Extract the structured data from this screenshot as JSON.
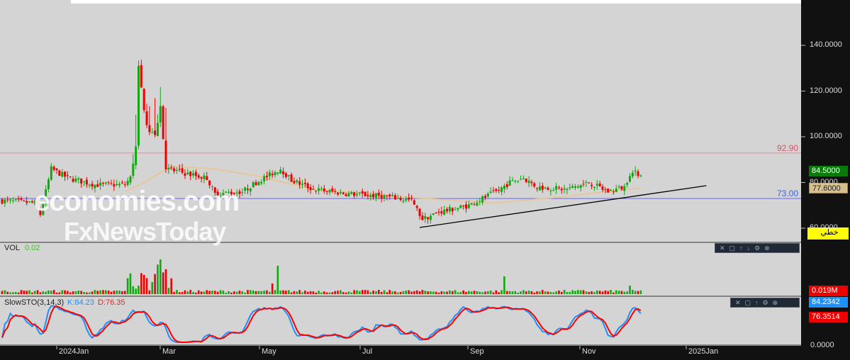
{
  "price_axis": {
    "ticks": [
      "140.0000",
      "120.0000",
      "100.0000",
      "80.0000",
      "60.0000"
    ],
    "last_price": "84.5000",
    "ma_value": "77.6000",
    "tool_label": "خطي"
  },
  "levels": {
    "resistance": "92.90",
    "support": "73.00"
  },
  "volume": {
    "label": "VOL",
    "value": "0.02",
    "axis_value": "0.019M"
  },
  "stoch": {
    "label": "SlowSTO(3,14,3)",
    "k": "K:84.23",
    "d": "D:76.35",
    "k_axis": "84.2342",
    "d_axis": "76.3514",
    "zero": "0.0000"
  },
  "x_axis": [
    "2024Jan",
    "Mar",
    "May",
    "Jul",
    "Sep",
    "Nov",
    "2025Jan"
  ],
  "watermark": {
    "line1": "economies.com",
    "line2": "FxNewsToday"
  },
  "toolbar_icons": [
    "close-icon",
    "window-icon",
    "up-icon",
    "down-icon",
    "settings-icon",
    "close-circle-icon"
  ],
  "colors": {
    "up": "#11a811",
    "down": "#ee0000",
    "ma": "#e6c79a",
    "resistance": "#e88a96",
    "support": "#6a6ae0",
    "k": "#1e90ff",
    "d": "#ff0000"
  },
  "chart_data": {
    "type": "candlestick",
    "title": "",
    "ylim": [
      55,
      150
    ],
    "x_ticks": [
      "2024Jan",
      "Mar",
      "May",
      "Jul",
      "Sep",
      "Nov",
      "2025Jan"
    ],
    "close_path_anchors": [
      [
        0,
        72
      ],
      [
        12,
        71
      ],
      [
        14,
        66
      ],
      [
        18,
        86
      ],
      [
        24,
        82
      ],
      [
        34,
        79
      ],
      [
        45,
        79
      ],
      [
        47,
        82
      ],
      [
        49,
        96
      ],
      [
        50,
        130
      ],
      [
        53,
        104
      ],
      [
        56,
        100
      ],
      [
        58,
        114
      ],
      [
        60,
        86
      ],
      [
        67,
        84
      ],
      [
        75,
        82
      ],
      [
        78,
        75
      ],
      [
        88,
        76
      ],
      [
        93,
        80
      ],
      [
        102,
        86
      ],
      [
        106,
        81
      ],
      [
        114,
        77
      ],
      [
        127,
        75
      ],
      [
        140,
        74
      ],
      [
        150,
        72
      ],
      [
        154,
        64
      ],
      [
        160,
        67
      ],
      [
        171,
        70
      ],
      [
        181,
        76
      ],
      [
        186,
        80
      ],
      [
        191,
        82
      ],
      [
        196,
        78
      ],
      [
        207,
        77
      ],
      [
        215,
        80
      ],
      [
        222,
        76
      ],
      [
        228,
        78
      ],
      [
        230,
        84
      ],
      [
        234,
        84
      ]
    ],
    "ma_anchors": [
      [
        45,
        76
      ],
      [
        52,
        80
      ],
      [
        62,
        87
      ],
      [
        77,
        86
      ],
      [
        93,
        83
      ],
      [
        114,
        77
      ],
      [
        135,
        75
      ],
      [
        155,
        73
      ],
      [
        181,
        71
      ],
      [
        207,
        74
      ],
      [
        222,
        76
      ],
      [
        234,
        77.6
      ]
    ],
    "horizontal_lines": [
      92.9,
      73.0
    ],
    "trendline": [
      [
        153,
        60.3
      ],
      [
        258,
        78.6
      ]
    ]
  }
}
